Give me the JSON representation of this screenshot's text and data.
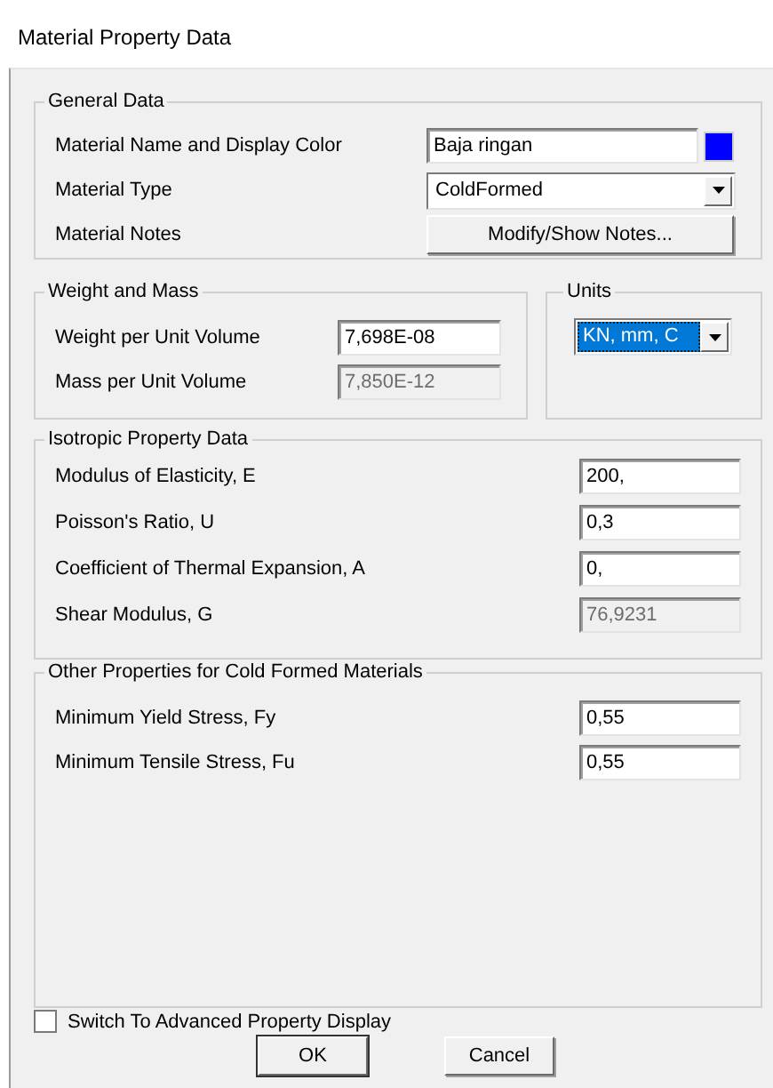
{
  "window": {
    "title": "Material Property Data"
  },
  "general_data": {
    "title": "General Data",
    "rows": [
      {
        "kind": "text",
        "label": "Material Name and Display Color",
        "value": "Baja ringan",
        "color": "#0000ff"
      },
      {
        "kind": "combo",
        "label": "Material Type",
        "value": "ColdFormed"
      },
      {
        "kind": "button",
        "label": "Material Notes",
        "value": "Modify/Show Notes..."
      }
    ]
  },
  "weight_and_mass": {
    "title": "Weight and Mass",
    "rows": [
      {
        "label": "Weight per Unit Volume",
        "value": "7,698E-08",
        "disabled": false
      },
      {
        "label": "Mass per Unit Volume",
        "value": "7,850E-12",
        "disabled": true
      }
    ]
  },
  "units": {
    "title": "Units",
    "value": "KN, mm, C",
    "focused": true
  },
  "isotropic_property_data": {
    "title": "Isotropic Property Data",
    "rows": [
      {
        "label": "Modulus of Elasticity,  E",
        "value": "200,",
        "disabled": false
      },
      {
        "label": "Poisson's Ratio,  U",
        "value": "0,3",
        "disabled": false
      },
      {
        "label": "Coefficient of Thermal Expansion,  A",
        "value": "0,",
        "disabled": false
      },
      {
        "label": "Shear Modulus,  G",
        "value": "76,9231",
        "disabled": true
      }
    ]
  },
  "cold_formed_properties": {
    "title": "Other Properties for Cold Formed Materials",
    "rows": [
      {
        "label": "Minimum Yield Stress, Fy",
        "value": "0,55",
        "disabled": false
      },
      {
        "label": "Minimum Tensile Stress, Fu",
        "value": "0,55",
        "disabled": false
      }
    ]
  },
  "advanced_display": {
    "label": "Switch To Advanced Property Display",
    "checked": false
  },
  "buttons": [
    {
      "label": "OK",
      "default": true
    },
    {
      "label": "Cancel",
      "default": false
    }
  ]
}
